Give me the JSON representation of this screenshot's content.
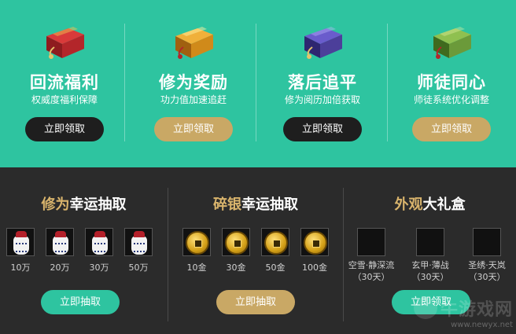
{
  "top_cards": [
    {
      "title": "回流福利",
      "subtitle": "权威度福利保障",
      "button": "立即领取",
      "box_color": "#b3262a",
      "button_style": "dark"
    },
    {
      "title": "修为奖励",
      "subtitle": "功力值加速追赶",
      "button": "立即领取",
      "box_color": "#d08a1a",
      "button_style": "gold"
    },
    {
      "title": "落后追平",
      "subtitle": "修为阅历加倍获取",
      "button": "立即领取",
      "box_color": "#4c3f9a",
      "button_style": "dark"
    },
    {
      "title": "师徒同心",
      "subtitle": "师徒系统优化调整",
      "button": "立即领取",
      "box_color": "#6b9a3a",
      "button_style": "gold"
    }
  ],
  "lottery_cultivation": {
    "heading_hl": "修为",
    "heading_rest": "幸运抽取",
    "items": [
      "10万",
      "20万",
      "30万",
      "50万"
    ],
    "button": "立即抽取"
  },
  "lottery_silver": {
    "heading_hl": "碎银",
    "heading_rest": "幸运抽取",
    "items": [
      "10金",
      "30金",
      "50金",
      "100金"
    ],
    "button": "立即抽取"
  },
  "gift_box": {
    "heading_hl": "外观",
    "heading_rest": "大礼盒",
    "items": [
      {
        "line1": "空雪·静深流",
        "line2": "（30天）"
      },
      {
        "line1": "玄甲·薄战",
        "line2": "（30天）"
      },
      {
        "line1": "圣绣·天岚",
        "line2": "（30天）"
      }
    ],
    "button": "立即领取"
  },
  "watermark": {
    "brand": "牛游戏网",
    "url": "www.newyx.net"
  },
  "colors": {
    "teal": "#2ec4a0",
    "dark_bg": "#2b2b2b",
    "gold": "#c9a865",
    "heading_gold": "#d9b46c"
  }
}
